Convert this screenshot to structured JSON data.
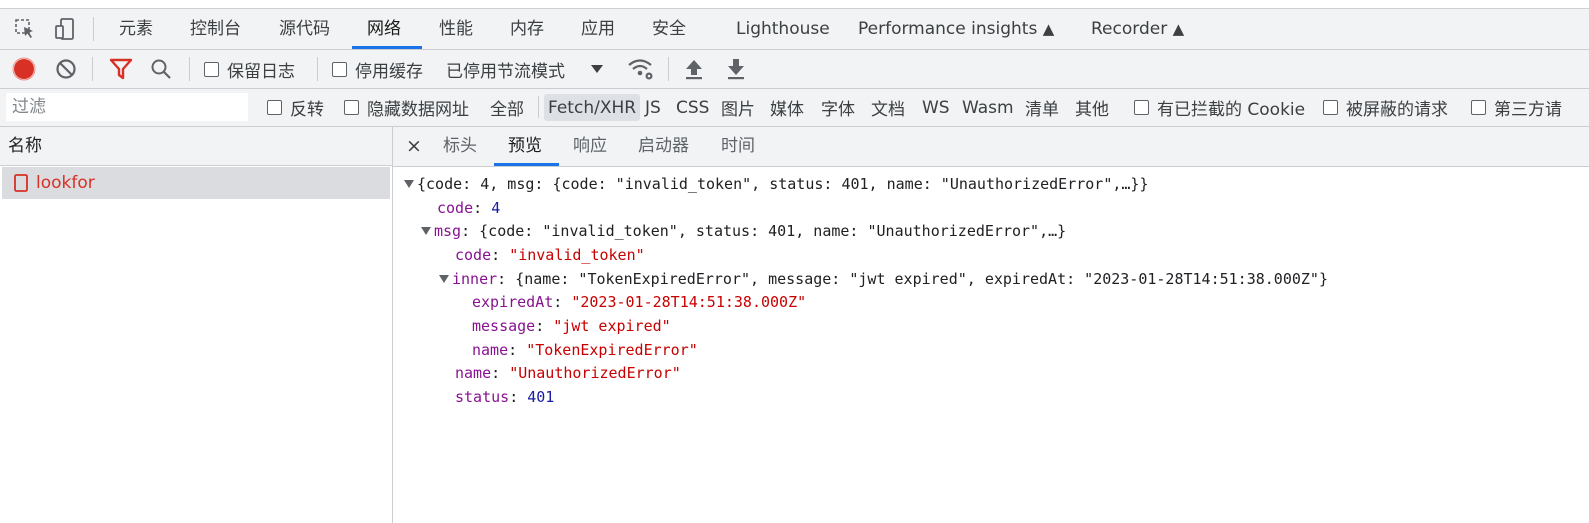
{
  "tabs": {
    "items": [
      "元素",
      "控制台",
      "源代码",
      "网络",
      "性能",
      "内存",
      "应用",
      "安全",
      "Lighthouse",
      "Performance insights",
      "Recorder"
    ],
    "active": "网络"
  },
  "toolbar": {
    "preserve_log": "保留日志",
    "disable_cache": "停用缓存",
    "throttle": "已停用节流模式"
  },
  "filter": {
    "placeholder": "过滤",
    "invert": "反转",
    "hide_data_urls": "隐藏数据网址",
    "types": [
      "全部",
      "Fetch/XHR",
      "JS",
      "CSS",
      "图片",
      "媒体",
      "字体",
      "文档",
      "WS",
      "Wasm",
      "清单",
      "其他"
    ],
    "active_type": "Fetch/XHR",
    "blocked_cookies": "有已拦截的 Cookie",
    "blocked_requests": "被屏蔽的请求",
    "third_party": "第三方请"
  },
  "requests": {
    "header": "名称",
    "items": [
      {
        "name": "lookfor"
      }
    ]
  },
  "detail_tabs": {
    "close": "×",
    "items": [
      "标头",
      "预览",
      "响应",
      "启动器",
      "时间"
    ],
    "active": "预览"
  },
  "preview": {
    "root_summary": "{code: 4, msg: {code: \"invalid_token\", status: 401, name: \"UnauthorizedError\",…}}",
    "code_key": "code",
    "code_value": "4",
    "msg_key": "msg",
    "msg_summary": "{code: \"invalid_token\", status: 401, name: \"UnauthorizedError\",…}",
    "msg_code_key": "code",
    "msg_code_value": "\"invalid_token\"",
    "inner_key": "inner",
    "inner_summary": "{name: \"TokenExpiredError\", message: \"jwt expired\", expiredAt: \"2023-01-28T14:51:38.000Z\"}",
    "expiredAt_key": "expiredAt",
    "expiredAt_value": "\"2023-01-28T14:51:38.000Z\"",
    "message_key": "message",
    "message_value": "\"jwt expired\"",
    "inner_name_key": "name",
    "inner_name_value": "\"TokenExpiredError\"",
    "msg_name_key": "name",
    "msg_name_value": "\"UnauthorizedError\"",
    "status_key": "status",
    "status_value": "401"
  },
  "colors": {
    "accent": "#1a73e8",
    "record": "#d93025",
    "key": "#881391",
    "string": "#c80000",
    "number": "#1a1aa6"
  }
}
